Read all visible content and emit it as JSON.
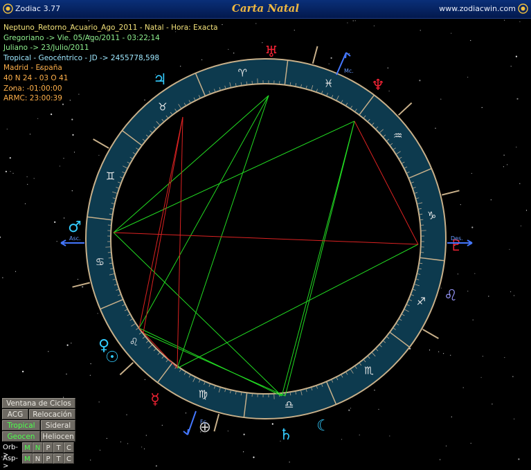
{
  "app": {
    "name": "Zodiac 3.77",
    "window_title": "Carta Natal",
    "site": "www.zodiacwin.com"
  },
  "info": {
    "line1": "Neptuno_Retorno_Acuario_Ago_2011 - Natal - Hora: Exacta",
    "line2": "Gregoriano -> Vie. 05/Ago/2011 - 03:22:14",
    "line3": "Juliano -> 23/Julio/2011",
    "line4": "Tropical - Geocéntrico - JD -> 2455778,598",
    "line5": "Madrid - España",
    "line6": "40 N 24 - 03 O 41",
    "line7": "Zona: -01:00:00",
    "line8": "ARMC: 23:00:39"
  },
  "labels": {
    "asc": "Asc.",
    "mc": "Mc.",
    "des": "Des.",
    "fc": "Fc."
  },
  "buttons": {
    "ciclos": "Ventana de Ciclos",
    "acg": "ACG",
    "relocacion": "Relocación",
    "tropical": "Tropical",
    "sideral": "Sideral",
    "geocen": "Geocen",
    "heliocen": "Heliocen",
    "orb_label": "Orb->",
    "asp_label": "Asp->",
    "m": "M",
    "n": "N",
    "p": "P",
    "t": "T",
    "c": "C"
  },
  "colors": {
    "ring_fill": "#0d3a4e",
    "ring_border": "#c8b08a",
    "aspect_green": "#22dd22",
    "aspect_red": "#dd2222",
    "planet_cyan": "#33ccff",
    "planet_red": "#ee2233"
  }
}
